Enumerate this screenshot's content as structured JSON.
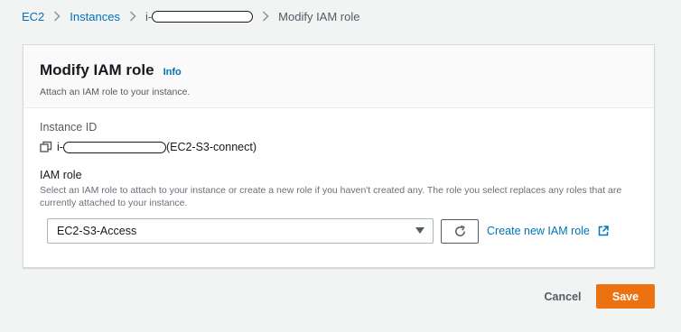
{
  "breadcrumb": {
    "ec2": "EC2",
    "instances": "Instances",
    "instance_prefix": "i-",
    "current": "Modify IAM role"
  },
  "header": {
    "title": "Modify IAM role",
    "info": "Info",
    "description": "Attach an IAM role to your instance."
  },
  "instance": {
    "label": "Instance ID",
    "id_prefix": "i-",
    "name": "(EC2-S3-connect)"
  },
  "iam_role": {
    "label": "IAM role",
    "description": "Select an IAM role to attach to your instance or create a new role if you haven't created any. The role you select replaces any roles that are currently attached to your instance.",
    "selected": "EC2-S3-Access",
    "create_link": "Create new IAM role"
  },
  "actions": {
    "cancel": "Cancel",
    "save": "Save"
  },
  "colors": {
    "link": "#0073bb",
    "primary": "#ec7211",
    "background": "#f2f3f3"
  },
  "icons": [
    "chevron-right-icon",
    "copy-icon",
    "caret-down-icon",
    "refresh-icon",
    "external-link-icon"
  ]
}
